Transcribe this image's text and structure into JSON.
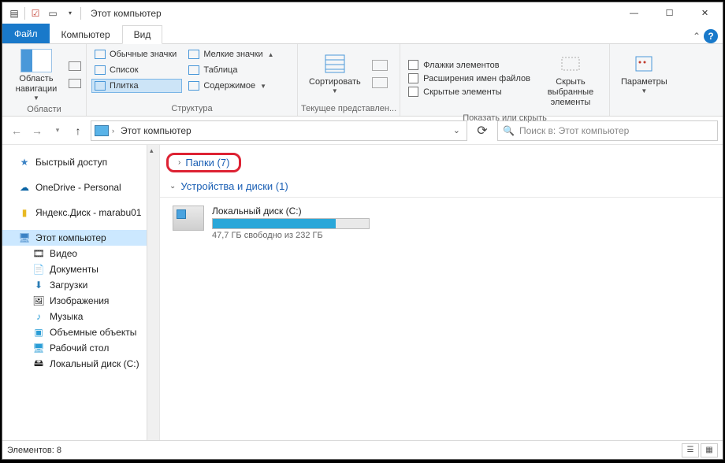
{
  "window": {
    "title": "Этот компьютер"
  },
  "tabs": {
    "file": "Файл",
    "computer": "Компьютер",
    "view": "Вид"
  },
  "ribbon": {
    "group_areas": "Области",
    "nav_pane": "Область навигации",
    "group_layout": "Структура",
    "layout_items": {
      "regular": "Обычные значки",
      "small": "Мелкие значки",
      "tiles": "Плитка",
      "list": "Список",
      "table": "Таблица",
      "content": "Содержимое"
    },
    "group_current": "Текущее представлен...",
    "sort": "Сортировать",
    "group_show": "Показать или скрыть",
    "chk_flags": "Флажки элементов",
    "chk_ext": "Расширения имен файлов",
    "chk_hidden": "Скрытые элементы",
    "hide_selected": "Скрыть выбранные элементы",
    "options": "Параметры"
  },
  "address": {
    "location": "Этот компьютер",
    "search_placeholder": "Поиск в: Этот компьютер"
  },
  "sidebar": {
    "quick": "Быстрый доступ",
    "onedrive": "OneDrive - Personal",
    "yandex": "Яндекс.Диск - marabu01",
    "thispc": "Этот компьютер",
    "video": "Видео",
    "documents": "Документы",
    "downloads": "Загрузки",
    "pictures": "Изображения",
    "music": "Музыка",
    "objects3d": "Объемные объекты",
    "desktop": "Рабочий стол",
    "localdisk": "Локальный диск (C:)"
  },
  "main": {
    "folders_header": "Папки (7)",
    "devices_header": "Устройства и диски (1)",
    "drive_name": "Локальный диск (C:)",
    "drive_free": "47,7 ГБ свободно из 232 ГБ"
  },
  "status": {
    "items": "Элементов: 8"
  }
}
